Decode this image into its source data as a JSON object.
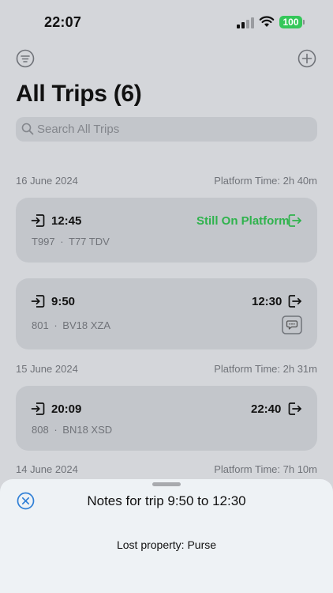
{
  "status": {
    "time": "22:07",
    "battery": "100"
  },
  "header": {
    "title": "All Trips (6)"
  },
  "search": {
    "placeholder": "Search All Trips"
  },
  "groups": [
    {
      "date": "16 June 2024",
      "platform_time": "Platform Time: 2h 40m",
      "trips": [
        {
          "start": "12:45",
          "end_status": "Still On Platform",
          "train": "T997",
          "unit": "T77 TDV"
        },
        {
          "start": "9:50",
          "end": "12:30",
          "train": "801",
          "unit": "BV18 XZA",
          "has_note": true
        }
      ]
    },
    {
      "date": "15 June 2024",
      "platform_time": "Platform Time: 2h 31m",
      "trips": [
        {
          "start": "20:09",
          "end": "22:40",
          "train": "808",
          "unit": "BN18 XSD"
        }
      ]
    },
    {
      "date": "14 June 2024",
      "platform_time": "Platform Time: 7h 10m",
      "trips": []
    }
  ],
  "sep": "·",
  "sheet": {
    "title": "Notes for trip 9:50 to 12:30",
    "note": "Lost property: Purse"
  },
  "colors": {
    "accent": "#2f7fd6",
    "green": "#2fb34d",
    "battery": "#34c759"
  }
}
